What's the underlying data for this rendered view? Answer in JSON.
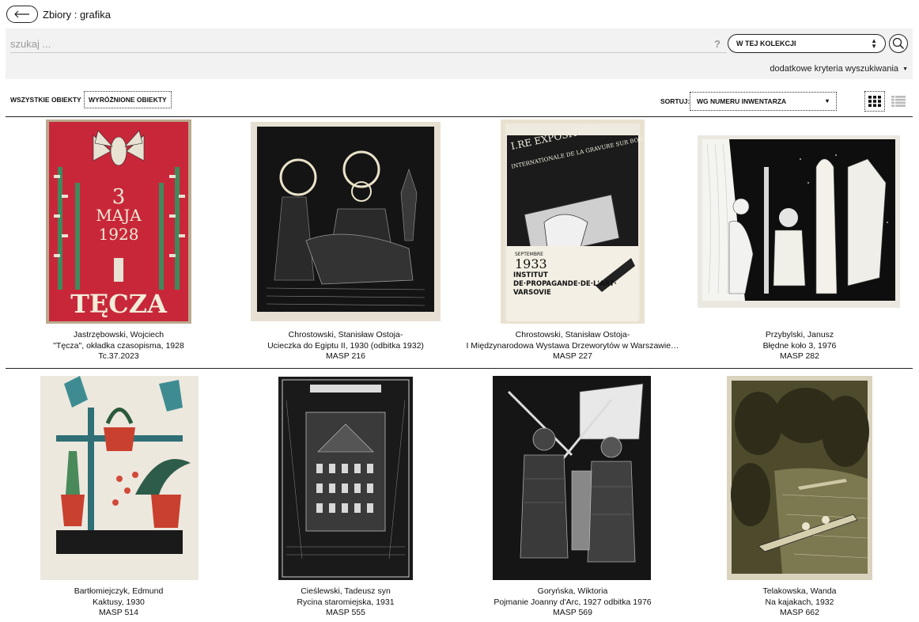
{
  "header": {
    "breadcrumb": "Zbiory : grafika"
  },
  "search": {
    "placeholder": "szukaj ...",
    "help": "?",
    "scope": "W TEJ KOLEKCJI",
    "advanced": "dodatkowe kryteria wyszukiwania"
  },
  "filters": {
    "all": "WSZYSTKIE OBIEKTY",
    "featured": "WYRÓŻNIONE OBIEKTY",
    "sort_label": "SORTUJ:",
    "sort_value": "WG NUMERU INWENTARZA"
  },
  "items": [
    {
      "author": "Jastrzębowski, Wojciech",
      "title": "\"Tęcza\", okładka czasopisma, 1928",
      "inv": "Tc.37.2023",
      "poster_line1": "3",
      "poster_line2": "MAJA",
      "poster_line3": "1928",
      "poster_word": "TĘCZA"
    },
    {
      "author": "Chrostowski, Stanisław Ostoja-",
      "title": "Ucieczka do Egiptu II, 1930 (odbitka 1932)",
      "inv": "MASP 216"
    },
    {
      "author": "Chrostowski, Stanisław Ostoja-",
      "title": "I Międzynarodowa Wystawa Drzeworytów w Warszawie…",
      "inv": "MASP 227",
      "poster_a": "I.RE EXPOSITION",
      "poster_b": "INTERNATIONALE DE LA GRAVURE SUR BOIS ORIGINALE",
      "poster_c": "SEPTEMBRE",
      "poster_d": "1933",
      "poster_e": "INSTITUT DE·PROPAGANDE·DE·L'ART· VARSOVIE"
    },
    {
      "author": "Przybylski, Janusz",
      "title": "Błędne koło 3, 1976",
      "inv": "MASP 282"
    },
    {
      "author": "Bartłomiejczyk, Edmund",
      "title": "Kaktusy, 1930",
      "inv": "MASP 514"
    },
    {
      "author": "Cieślewski, Tadeusz syn",
      "title": "Rycina staromiejska, 1931",
      "inv": "MASP 555"
    },
    {
      "author": "Goryńska, Wiktoria",
      "title": "Pojmanie Joanny d'Arc, 1927 odbitka 1976",
      "inv": "MASP 569"
    },
    {
      "author": "Telakowska, Wanda",
      "title": "Na kajakach, 1932",
      "inv": "MASP 662"
    }
  ],
  "colors": {
    "accent": "#222222",
    "panel": "#f2f2f2",
    "poster_red": "#c8273a"
  }
}
